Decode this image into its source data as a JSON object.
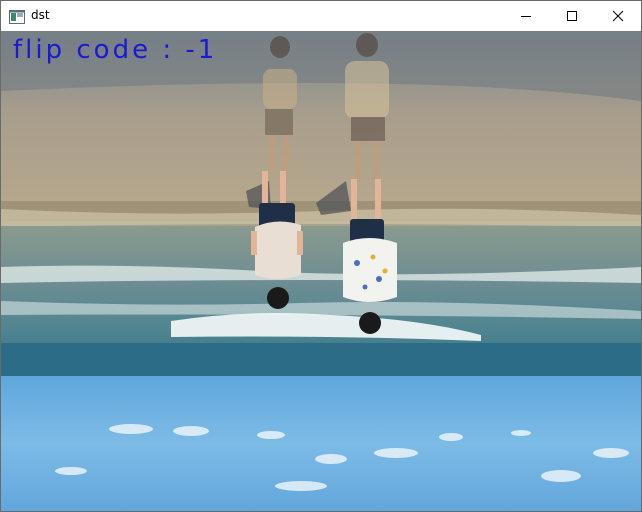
{
  "window": {
    "title": "dst",
    "controls": {
      "minimize_icon": "minimize-icon",
      "maximize_icon": "maximize-icon",
      "close_icon": "close-icon"
    }
  },
  "image": {
    "overlay_text": "flip code : -1",
    "overlay_color": "#1a1ad6",
    "content": "vertically and horizontally flipped beach photo with two children"
  }
}
